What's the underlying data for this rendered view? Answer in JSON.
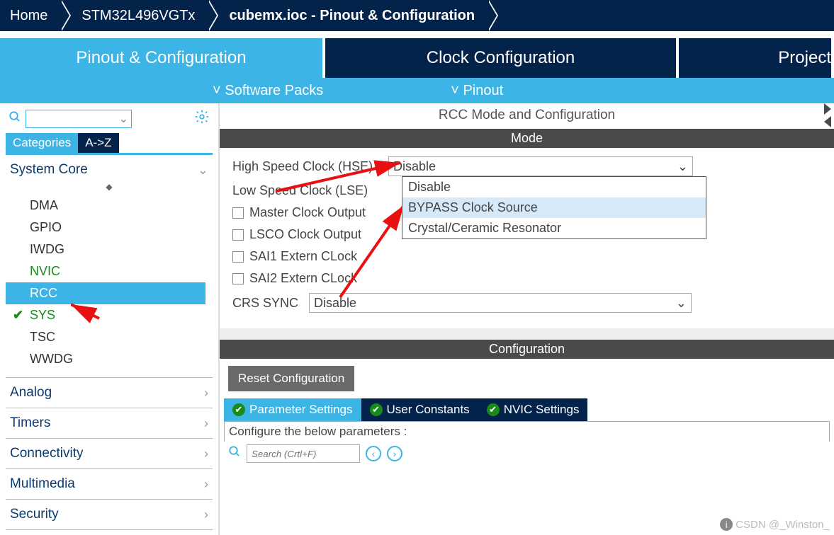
{
  "breadcrumb": {
    "home": "Home",
    "chip": "STM32L496VGTx",
    "file": "cubemx.ioc - Pinout & Configuration"
  },
  "toptabs": {
    "pinout": "Pinout & Configuration",
    "clock": "Clock Configuration",
    "project": "Project"
  },
  "subbar": {
    "packs": "Software Packs",
    "pinout": "Pinout"
  },
  "left": {
    "tabs": {
      "categories": "Categories",
      "az": "A->Z"
    },
    "groups": {
      "system_core": {
        "label": "System Core",
        "items": [
          "DMA",
          "GPIO",
          "IWDG",
          "NVIC",
          "RCC",
          "SYS",
          "TSC",
          "WWDG"
        ]
      },
      "analog": "Analog",
      "timers": "Timers",
      "connectivity": "Connectivity",
      "multimedia": "Multimedia",
      "security": "Security"
    }
  },
  "right": {
    "title": "RCC Mode and Configuration",
    "mode_label": "Mode",
    "hse_label": "High Speed Clock (HSE)",
    "hse_value": "Disable",
    "hse_options": [
      "Disable",
      "BYPASS Clock Source",
      "Crystal/Ceramic Resonator"
    ],
    "lse_label": "Low Speed Clock (LSE)",
    "mco_label": "Master Clock Output",
    "lsco_label": "LSCO Clock Output",
    "sai1_label": "SAI1 Extern CLock",
    "sai2_label": "SAI2 Extern CLock",
    "crs_label": "CRS SYNC",
    "crs_value": "Disable",
    "config_label": "Configuration",
    "reset_btn": "Reset Configuration",
    "cfg_tabs": {
      "param": "Parameter Settings",
      "user": "User Constants",
      "nvic": "NVIC Settings"
    },
    "param_prompt": "Configure the below parameters :",
    "param_search_placeholder": "Search (Crtl+F)"
  },
  "watermark": "CSDN @_Winston_"
}
